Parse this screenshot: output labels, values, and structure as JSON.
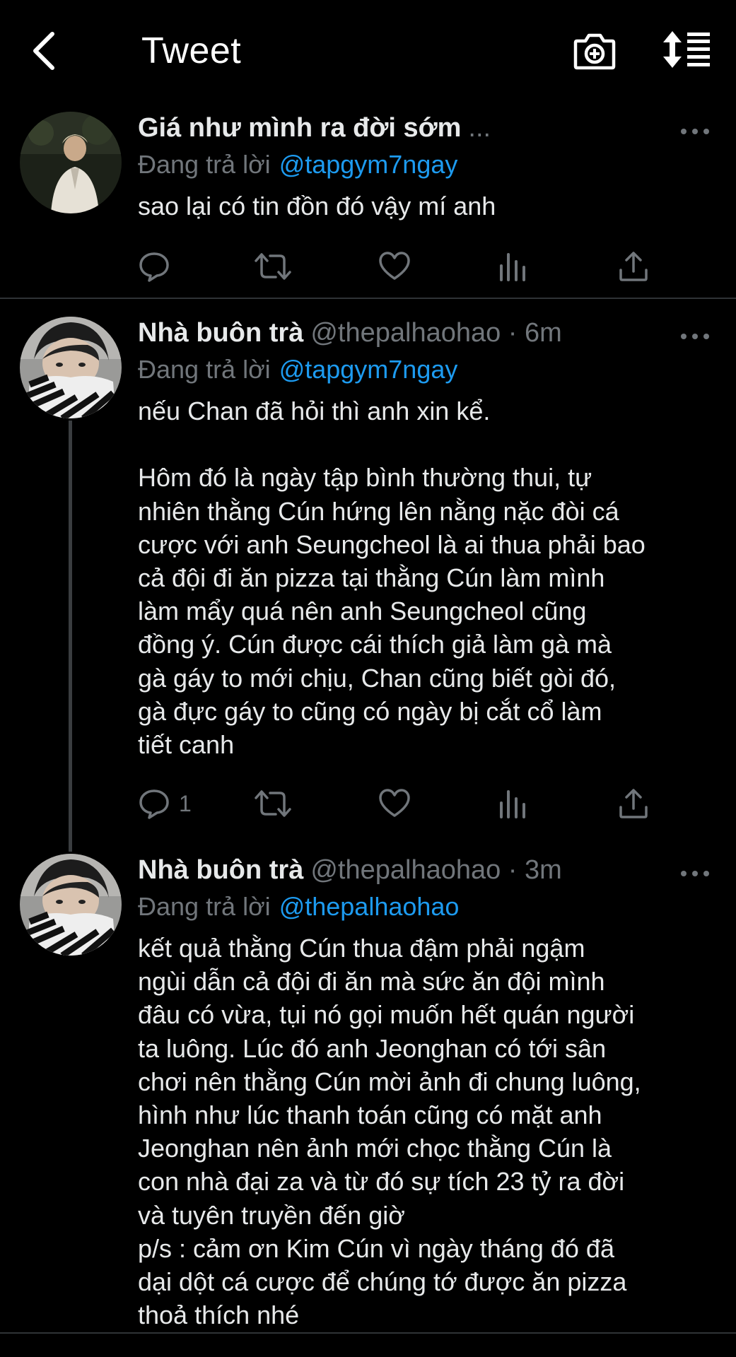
{
  "header": {
    "title": "Tweet",
    "back_icon": "chevron-left-icon",
    "camera_icon": "camera-plus-icon",
    "sort_icon": "sort-list-icon"
  },
  "tweets": [
    {
      "display_name": "Giá như mình ra đời sớm",
      "handle_meta": "...",
      "reply_prefix": "Đang trả lời",
      "reply_to": "@tapgym7ngay",
      "text": "sao lại có tin đồn đó vậy mí anh",
      "reply_count": ""
    },
    {
      "display_name": "Nhà buôn trà",
      "handle_meta": "@thepalhaohao · 6m",
      "reply_prefix": "Đang trả lời",
      "reply_to": "@tapgym7ngay",
      "text": "nếu Chan đã hỏi thì anh xin kể.\n\nHôm đó là ngày tập bình thường thui, tự\nnhiên thằng Cún hứng lên nằng nặc đòi cá\ncược với anh Seungcheol là ai thua phải bao\ncả đội đi ăn pizza tại thằng Cún làm mình\nlàm mẩy quá nên anh Seungcheol cũng\nđồng ý. Cún được cái thích giả làm gà mà\ngà gáy to mới chịu, Chan cũng biết gòi đó,\ngà đực gáy to cũng có ngày bị cắt cổ làm\ntiết canh",
      "reply_count": "1"
    },
    {
      "display_name": "Nhà buôn trà",
      "handle_meta": "@thepalhaohao · 3m",
      "reply_prefix": "Đang trả lời",
      "reply_to": "@thepalhaohao",
      "text": "kết quả thằng Cún thua đậm phải ngậm\nngùi dẫn cả đội đi ăn mà sức ăn đội mình\nđâu có vừa, tụi nó gọi muốn hết quán người\nta luông. Lúc đó anh Jeonghan có tới sân\nchơi nên thằng Cún mời ảnh đi chung luông,\nhình như lúc thanh toán cũng có mặt anh\nJeonghan nên ảnh mới chọc thằng Cún là\ncon nhà đại za và từ đó sự tích 23 tỷ ra đời\nvà tuyên truyền đến giờ\np/s : cảm ơn Kim Cún vì ngày tháng đó đã\ndại dột cá cược để chúng tớ được ăn pizza\nthoả thích nhé"
    }
  ],
  "colors": {
    "background": "#000000",
    "text": "#e7e9ea",
    "muted": "#71767b",
    "link": "#1d9bf0",
    "divider": "#2f3336"
  },
  "icons": [
    "reply-icon",
    "retweet-icon",
    "like-icon",
    "views-icon",
    "share-icon",
    "more-icon"
  ]
}
